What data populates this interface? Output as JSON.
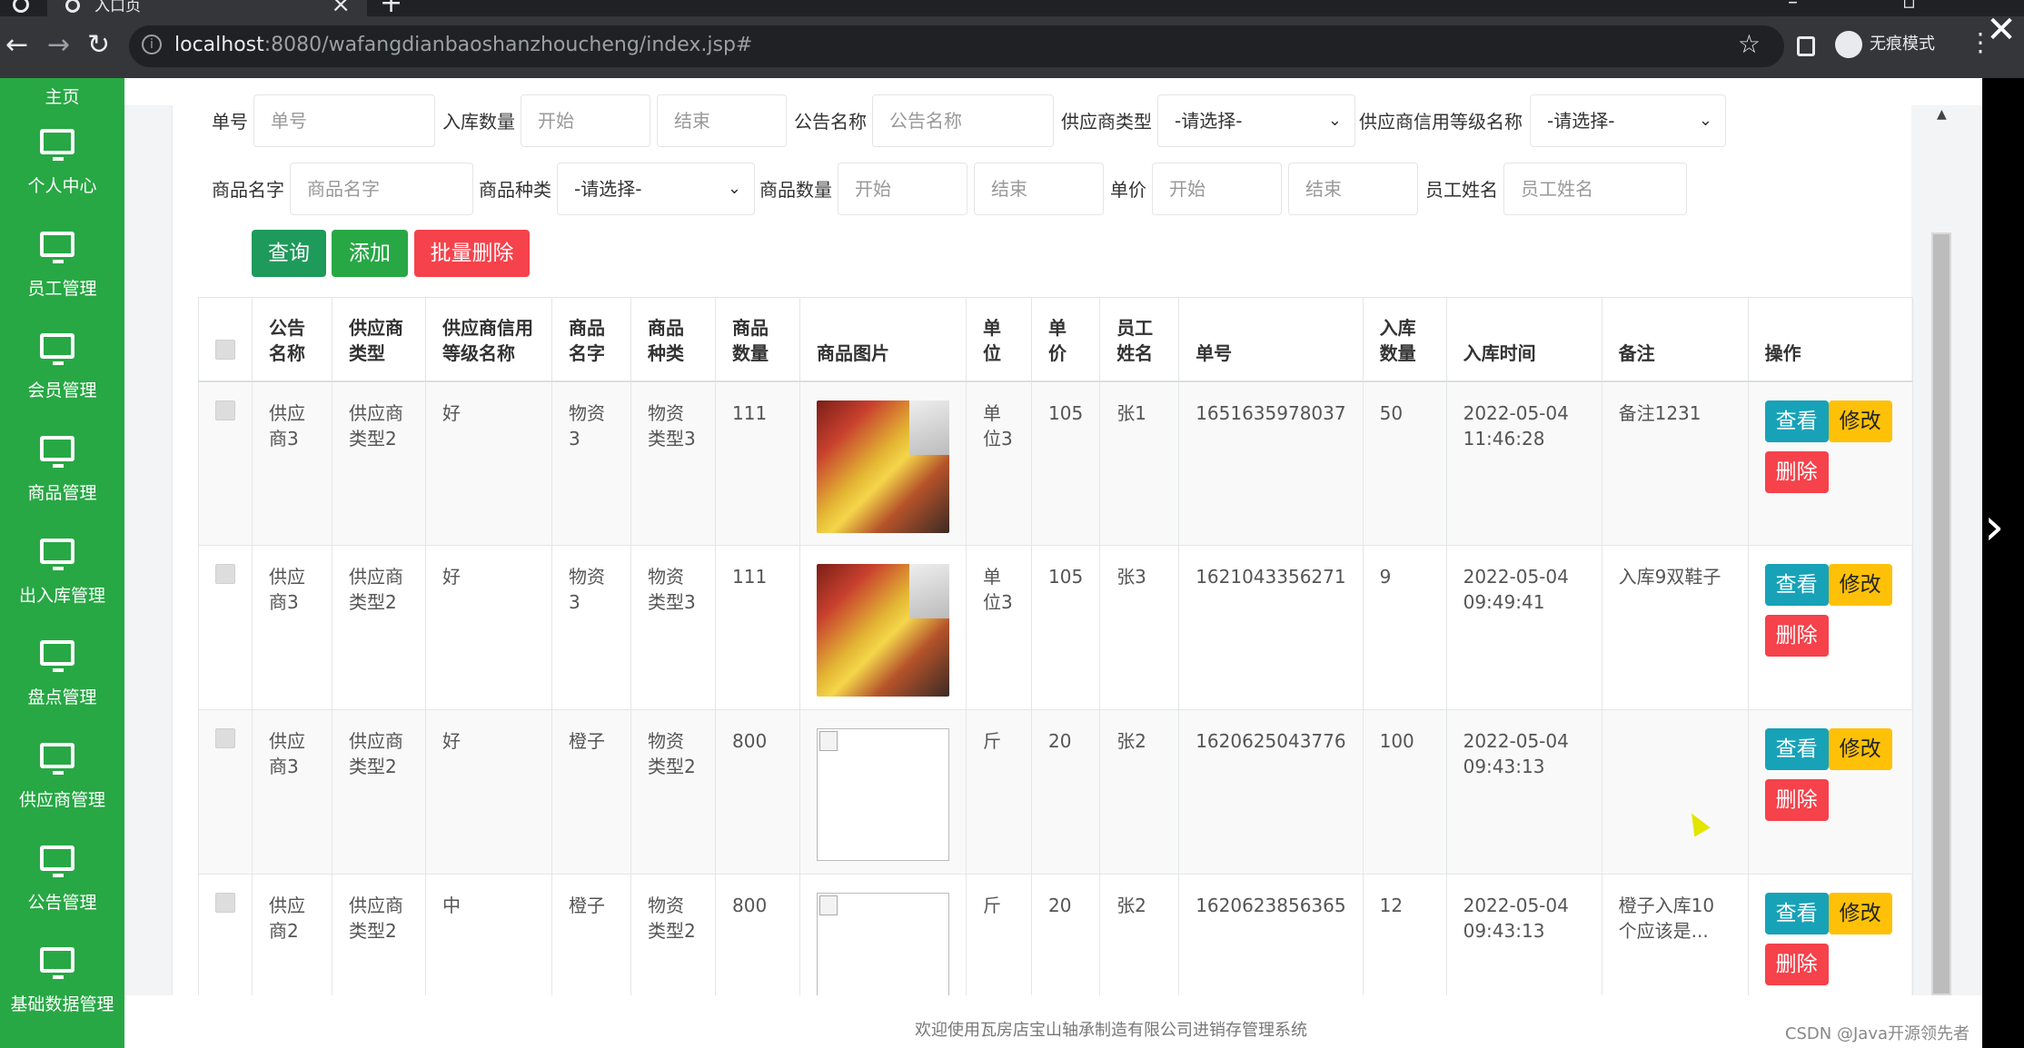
{
  "browser": {
    "tab_title": "入口页",
    "url_host": "localhost",
    "url_rest": ":8080/wafangdianbaoshanzhoucheng/index.jsp#",
    "incognito_label": "无痕模式"
  },
  "sidebar": {
    "items": [
      {
        "label": "主页"
      },
      {
        "label": "个人中心"
      },
      {
        "label": "员工管理"
      },
      {
        "label": "会员管理"
      },
      {
        "label": "商品管理"
      },
      {
        "label": "出入库管理"
      },
      {
        "label": "盘点管理"
      },
      {
        "label": "供应商管理"
      },
      {
        "label": "公告管理"
      },
      {
        "label": "基础数据管理"
      }
    ]
  },
  "filters": {
    "danhao": {
      "label": "单号",
      "placeholder": "单号"
    },
    "ruku_shuliang": {
      "label": "入库数量",
      "start": "开始",
      "end": "结束"
    },
    "gonggao_name": {
      "label": "公告名称",
      "placeholder": "公告名称"
    },
    "supplier_type": {
      "label": "供应商类型",
      "value": "-请选择-"
    },
    "supplier_credit": {
      "label": "供应商信用等级名称",
      "value": "-请选择-"
    },
    "goods_name": {
      "label": "商品名字",
      "placeholder": "商品名字"
    },
    "goods_kind": {
      "label": "商品种类",
      "value": "-请选择-"
    },
    "goods_count": {
      "label": "商品数量",
      "start": "开始",
      "end": "结束"
    },
    "price": {
      "label": "单价",
      "start": "开始",
      "end": "结束"
    },
    "employee": {
      "label": "员工姓名",
      "placeholder": "员工姓名"
    }
  },
  "buttons": {
    "query": "查询",
    "add": "添加",
    "batch_delete": "批量删除"
  },
  "colors": {
    "sidebar": "#27a844",
    "query": "#1e9a5a",
    "add": "#28a745",
    "batch_delete": "#f5424b",
    "view": "#17a2b8",
    "edit": "#ffc107",
    "delete": "#f5424b"
  },
  "table": {
    "headers": [
      "公告名称",
      "供应商类型",
      "供应商信用等级名称",
      "商品名字",
      "商品种类",
      "商品数量",
      "商品图片",
      "单位",
      "单价",
      "员工姓名",
      "单号",
      "入库数量",
      "入库时间",
      "备注",
      "操作"
    ],
    "action_labels": {
      "view": "查看",
      "edit": "修改",
      "delete": "删除"
    },
    "rows": [
      {
        "gonggao": "供应商3",
        "supplier_type": "供应商类型2",
        "credit": "好",
        "goods_name": "物资3",
        "goods_kind": "物资类型3",
        "count": "111",
        "image": "photo",
        "unit": "单位3",
        "price": "105",
        "employee": "张1",
        "danhao": "1651635978037",
        "qty": "50",
        "time": "2022-05-04 11:46:28",
        "note": "备注1231"
      },
      {
        "gonggao": "供应商3",
        "supplier_type": "供应商类型2",
        "credit": "好",
        "goods_name": "物资3",
        "goods_kind": "物资类型3",
        "count": "111",
        "image": "photo",
        "unit": "单位3",
        "price": "105",
        "employee": "张3",
        "danhao": "1621043356271",
        "qty": "9",
        "time": "2022-05-04 09:49:41",
        "note": "入库9双鞋子"
      },
      {
        "gonggao": "供应商3",
        "supplier_type": "供应商类型2",
        "credit": "好",
        "goods_name": "橙子",
        "goods_kind": "物资类型2",
        "count": "800",
        "image": "broken",
        "unit": "斤",
        "price": "20",
        "employee": "张2",
        "danhao": "1620625043776",
        "qty": "100",
        "time": "2022-05-04 09:43:13",
        "note": ""
      },
      {
        "gonggao": "供应商2",
        "supplier_type": "供应商类型2",
        "credit": "中",
        "goods_name": "橙子",
        "goods_kind": "物资类型2",
        "count": "800",
        "image": "broken",
        "unit": "斤",
        "price": "20",
        "employee": "张2",
        "danhao": "1620623856365",
        "qty": "12",
        "time": "2022-05-04 09:43:13",
        "note": "橙子入库10个应该是..."
      }
    ]
  },
  "footer": {
    "text": "欢迎使用瓦房店宝山轴承制造有限公司进销存管理系统",
    "watermark": "CSDN @Java开源领先者"
  }
}
